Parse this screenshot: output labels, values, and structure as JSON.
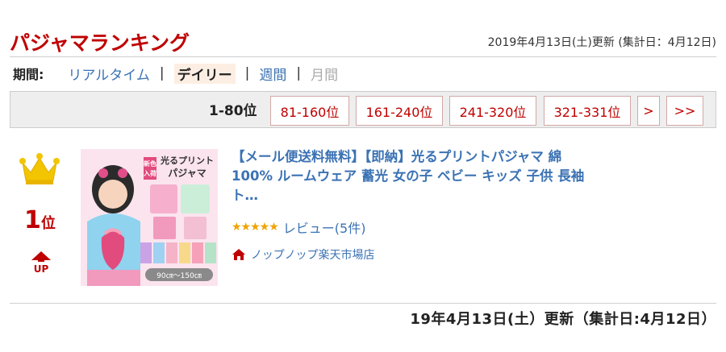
{
  "header": {
    "title": "パジャマランキング",
    "update_text": "2019年4月13日(土)更新 (集計日：4月12日)"
  },
  "period": {
    "label": "期間:",
    "options": [
      {
        "label": "リアルタイム",
        "state": "link"
      },
      {
        "label": "デイリー",
        "state": "active"
      },
      {
        "label": "週間",
        "state": "link"
      },
      {
        "label": "月間",
        "state": "disabled"
      }
    ],
    "separator": "|"
  },
  "pager": {
    "current": "1-80位",
    "pages": [
      "81-160位",
      "161-240位",
      "241-320位",
      "321-331位",
      ">",
      ">>"
    ]
  },
  "item": {
    "rank_number": "1",
    "rank_suffix": "位",
    "trend": "UP",
    "title": "【メール便送料無料】【即納】光るプリントパジャマ 綿100% ルームウェア 蓄光 女の子 ベビー キッズ 子供 長袖 ト…",
    "stars": "★★★★★",
    "reviews": "レビュー(5件)",
    "shop": "ノップノップ楽天市場店",
    "image_text": {
      "badge": "新色入荷",
      "headline1": "光るプリント",
      "headline2": "パジャマ",
      "sizes": "90㎝～150㎝"
    }
  },
  "footer": {
    "update_text": "19年4月13日(土）更新（集計日:4月12日）"
  },
  "colors": {
    "brand_red": "#bf0000",
    "link_blue": "#3b72b4",
    "crown_gold": "#f3c500",
    "star_orange": "#f0a300"
  }
}
